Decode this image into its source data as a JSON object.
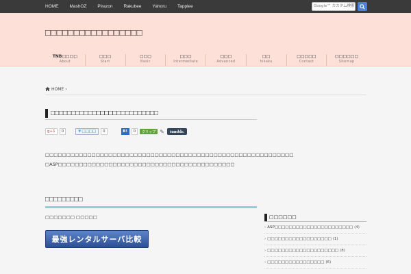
{
  "topnav": [
    "HOME",
    "MashOZ",
    "Pirazon",
    "Rakubee",
    "Yahoru",
    "Tapplee"
  ],
  "search": {
    "placeholder": "Google™ カスタム検索"
  },
  "site": {
    "title": "□□□□□□□□□□□□□□□□□"
  },
  "gnav": [
    {
      "main": "TNB□□□□",
      "sub": "About"
    },
    {
      "main": "□□□",
      "sub": "Start"
    },
    {
      "main": "□□□",
      "sub": "Basic"
    },
    {
      "main": "□□□",
      "sub": "Intermediate"
    },
    {
      "main": "□□□",
      "sub": "Advanced"
    },
    {
      "main": "□□",
      "sub": "hikaku"
    },
    {
      "main": "□□□□□",
      "sub": "Contact"
    },
    {
      "main": "□□□□□□",
      "sub": "Sitemap"
    }
  ],
  "breadcrumb": {
    "home": "HOME",
    "sep": "›"
  },
  "post": {
    "title": "□□□□□□□□□□□□□□□□□□□□□□□□□□",
    "body_line1": "□□□□□□□□□□□□□□□□□□□□□□□□□□□□□□□□□□□□□□□□□□□□□□□□□□□□□□□□□□□",
    "body_line2": "□ASP□□□□□□□□□□□□□□□□□□□□□□□□□□□□□□□□□□□□□□□□□□"
  },
  "social": {
    "gplus_label": "g+1",
    "gplus_count": "0",
    "tweet_label": "□□□□",
    "tweet_count": "0",
    "hatena_label": "B!",
    "hatena_count": "0",
    "clip_label": "クリップ",
    "tumblr_label": "tumblr."
  },
  "section": {
    "title": "□□□□□□□□□",
    "sub": "□□□□□□□ □□□□□",
    "banner": "最強レンタルサーバ比較"
  },
  "sidebar": {
    "title": "□□□□□□",
    "items": [
      {
        "label": "ASP□□□□□□□□□□□□□□□□□□□□□□",
        "count": "(4)"
      },
      {
        "label": "□□□□□□□□□□□□□□□□□□",
        "count": "(1)"
      },
      {
        "label": "□□□□□□□□□□□□□□□□□□□□",
        "count": "(8)"
      },
      {
        "label": "□□□□□□□□□□□□□□□□",
        "count": "(6)"
      }
    ]
  },
  "colors": {
    "topbar": "#3a3a3a",
    "header": "#fde0d8",
    "accent_line": "#8ccfd8",
    "search_button": "#4a84d6"
  }
}
